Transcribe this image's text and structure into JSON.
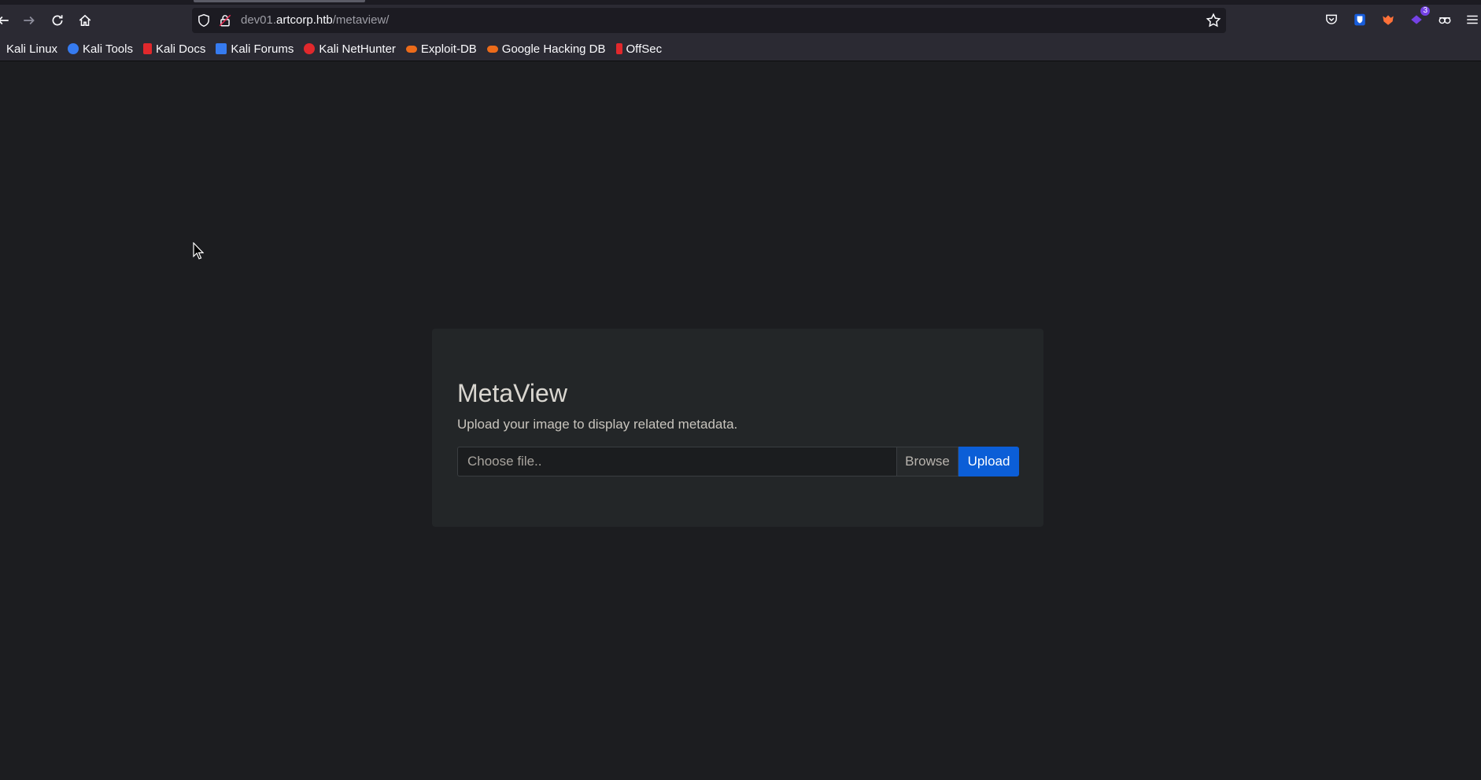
{
  "browser": {
    "url_prefix": "dev01.",
    "url_domain": "artcorp.htb",
    "url_path": "/metaview/",
    "extension_badge": "3",
    "bookmarks": [
      {
        "label": "Kali Linux",
        "color": "#367bf0"
      },
      {
        "label": "Kali Tools",
        "color": "#367bf0"
      },
      {
        "label": "Kali Docs",
        "color": "#e0282c"
      },
      {
        "label": "Kali Forums",
        "color": "#367bf0"
      },
      {
        "label": "Kali NetHunter",
        "color": "#e0282c"
      },
      {
        "label": "Exploit-DB",
        "color": "#ec6b1a"
      },
      {
        "label": "Google Hacking DB",
        "color": "#ec6b1a"
      },
      {
        "label": "OffSec",
        "color": "#e0282c"
      }
    ]
  },
  "page": {
    "title": "MetaView",
    "subtitle": "Upload your image to display related metadata.",
    "file_placeholder": "Choose file..",
    "browse_label": "Browse",
    "upload_label": "Upload",
    "accent_color": "#0b5ed7"
  }
}
